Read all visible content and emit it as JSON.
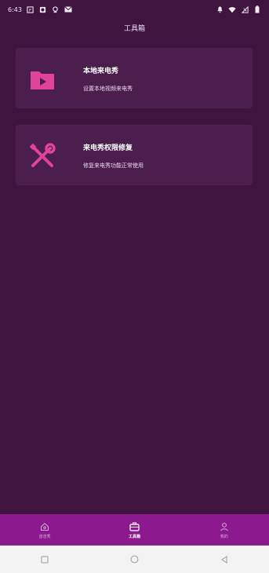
{
  "status": {
    "time": "6:43",
    "left_icons": [
      "app-icon-1",
      "app-icon-2",
      "app-icon-3",
      "mail-icon"
    ],
    "right_icons": [
      "notification-icon",
      "wifi-icon",
      "signal-icon",
      "battery-icon"
    ]
  },
  "header": {
    "title": "工具箱"
  },
  "cards": [
    {
      "title": "本地来电秀",
      "subtitle": "设置本地视频来电秀",
      "icon": "folder-play-icon"
    },
    {
      "title": "来电秀权限修复",
      "subtitle": "修复来电秀功能正常使用",
      "icon": "wrench-screwdriver-icon"
    }
  ],
  "nav": {
    "items": [
      {
        "label": "首音秀",
        "icon": "home-icon"
      },
      {
        "label": "工具箱",
        "icon": "toolbox-icon"
      },
      {
        "label": "我的",
        "icon": "user-icon"
      }
    ],
    "active_index": 1
  },
  "colors": {
    "background": "#3f1540",
    "card": "#4b1e4e",
    "accent": "#e0449a",
    "nav_bar": "#8c1a8e"
  }
}
